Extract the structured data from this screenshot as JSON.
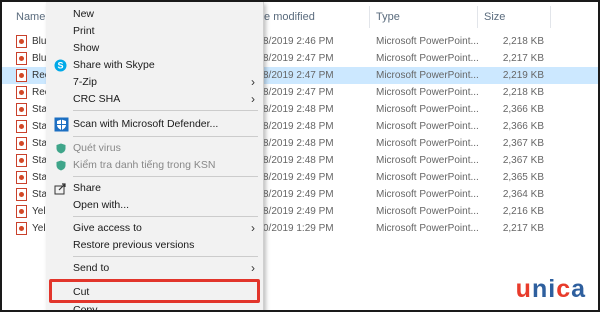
{
  "columns": {
    "name": "Name",
    "date_modified": "te modified",
    "type": "Type",
    "size": "Size"
  },
  "files": [
    {
      "name": "Blu",
      "date": "8/2019 2:46 PM",
      "type": "Microsoft PowerPoint...",
      "size": "2,218 KB",
      "selected": false
    },
    {
      "name": "Blu",
      "date": "8/2019 2:47 PM",
      "type": "Microsoft PowerPoint...",
      "size": "2,217 KB",
      "selected": false
    },
    {
      "name": "Rec",
      "date": "8/2019 2:47 PM",
      "type": "Microsoft PowerPoint...",
      "size": "2,219 KB",
      "selected": true
    },
    {
      "name": "Rec",
      "date": "8/2019 2:47 PM",
      "type": "Microsoft PowerPoint...",
      "size": "2,218 KB",
      "selected": false
    },
    {
      "name": "Sta",
      "date": "8/2019 2:48 PM",
      "type": "Microsoft PowerPoint...",
      "size": "2,366 KB",
      "selected": false
    },
    {
      "name": "Sta",
      "date": "8/2019 2:48 PM",
      "type": "Microsoft PowerPoint...",
      "size": "2,366 KB",
      "selected": false
    },
    {
      "name": "Sta",
      "date": "8/2019 2:48 PM",
      "type": "Microsoft PowerPoint...",
      "size": "2,367 KB",
      "selected": false
    },
    {
      "name": "Sta",
      "date": "8/2019 2:48 PM",
      "type": "Microsoft PowerPoint...",
      "size": "2,367 KB",
      "selected": false
    },
    {
      "name": "Sta",
      "date": "8/2019 2:49 PM",
      "type": "Microsoft PowerPoint...",
      "size": "2,365 KB",
      "selected": false
    },
    {
      "name": "Sta",
      "date": "8/2019 2:49 PM",
      "type": "Microsoft PowerPoint...",
      "size": "2,364 KB",
      "selected": false
    },
    {
      "name": "Yel",
      "date": "8/2019 2:49 PM",
      "type": "Microsoft PowerPoint...",
      "size": "2,216 KB",
      "selected": false
    },
    {
      "name": "Yel",
      "date": "0/2019 1:29 PM",
      "type": "Microsoft PowerPoint...",
      "size": "2,217 KB",
      "selected": false
    }
  ],
  "menu": {
    "new": "New",
    "print": "Print",
    "show": "Show",
    "share_skype": "Share with Skype",
    "zip7": "7-Zip",
    "crc_sha": "CRC SHA",
    "defender": "Scan with Microsoft Defender...",
    "quet_virus": "Quét virus",
    "ksn": "Kiểm tra danh tiếng trong KSN",
    "share": "Share",
    "open_with": "Open with...",
    "give_access": "Give access to",
    "restore": "Restore previous versions",
    "send_to": "Send to",
    "cut": "Cut",
    "copy": "Copy"
  },
  "logo": {
    "u": "u",
    "n": "n",
    "i": "i",
    "c": "c",
    "a": "a"
  },
  "colors": {
    "highlight": "#e2352b",
    "selection": "#cce8ff",
    "logo_red": "#e83b2b",
    "logo_blue": "#2e5f9e"
  }
}
